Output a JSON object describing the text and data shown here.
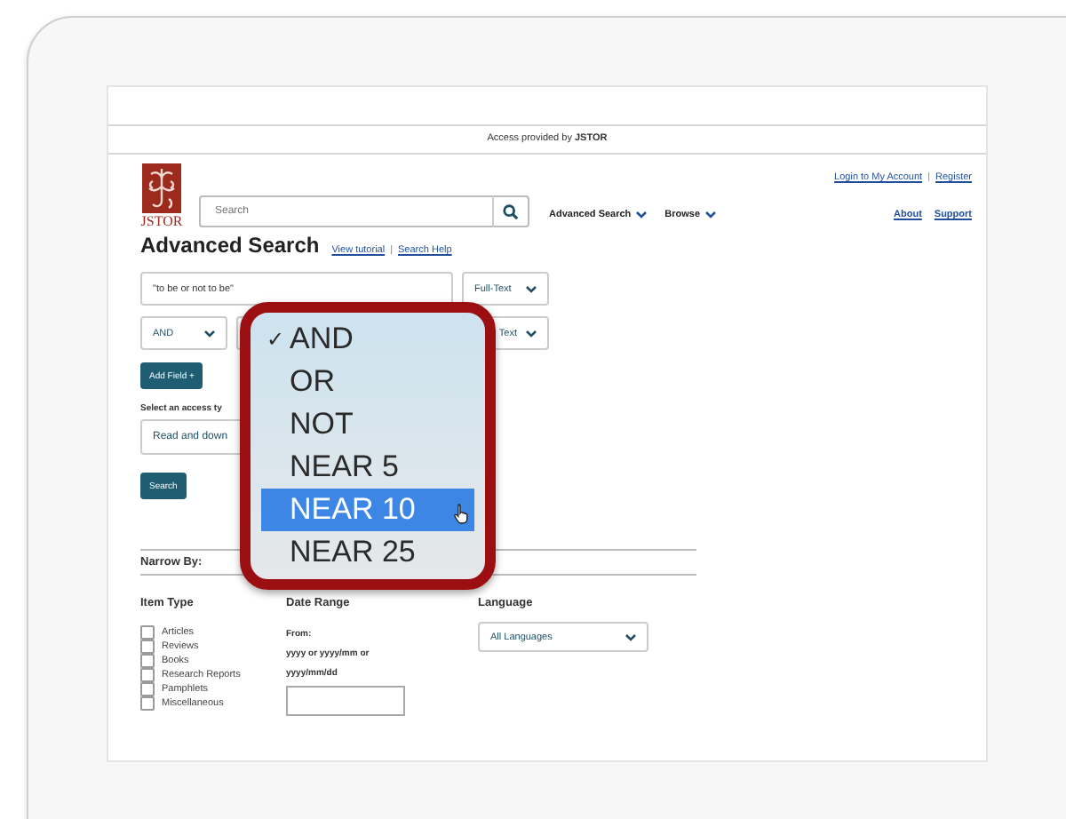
{
  "banner": "Access provided by **JSTOR**",
  "header": {
    "logo_text": "JSTOR",
    "search": {
      "placeholder": "Search"
    },
    "nav": [
      "Advanced Search",
      "Browse"
    ],
    "account_links": [
      "Login to My Account",
      "Register"
    ],
    "separator": "|",
    "links": [
      "About",
      "Support"
    ]
  },
  "page_title": "Advanced Search",
  "help_links": [
    "View tutorial",
    "Search Help"
  ],
  "help_separator": "|",
  "query_rows": [
    {
      "kind": "text",
      "value": "\"to be or not to be\"",
      "field_type": "Full-Text"
    },
    {
      "kind": "operator",
      "operator": "AND",
      "field_type": "Text"
    }
  ],
  "add_field_button": "Add Field +",
  "access_type": {
    "label": "Select an access ty",
    "value": "Read and down"
  },
  "search_button": "Search",
  "operator_menu": {
    "check_mark": "✓",
    "items": [
      {
        "label": "AND",
        "checked": true,
        "selected": false
      },
      {
        "label": "OR",
        "checked": false,
        "selected": false
      },
      {
        "label": "NOT",
        "checked": false,
        "selected": false
      },
      {
        "label": "NEAR 5",
        "checked": false,
        "selected": false
      },
      {
        "label": "NEAR 10",
        "checked": false,
        "selected": true
      },
      {
        "label": "NEAR 25",
        "checked": false,
        "selected": false
      }
    ]
  },
  "narrow_by": {
    "title": "Narrow By:",
    "item_type": {
      "heading": "Item Type",
      "options": [
        {
          "label": "Articles",
          "checked": false
        },
        {
          "label": "Reviews",
          "checked": false
        },
        {
          "label": "Books",
          "checked": false
        },
        {
          "label": "Research Reports",
          "checked": false
        },
        {
          "label": "Pamphlets",
          "checked": false
        },
        {
          "label": "Miscellaneous",
          "checked": false
        }
      ]
    },
    "date_range": {
      "heading": "Date Range",
      "from_label": "From:",
      "hint": "yyyy or yyyy/mm or yyyy/mm/dd"
    },
    "language": {
      "heading": "Language",
      "value": "All Languages"
    }
  }
}
